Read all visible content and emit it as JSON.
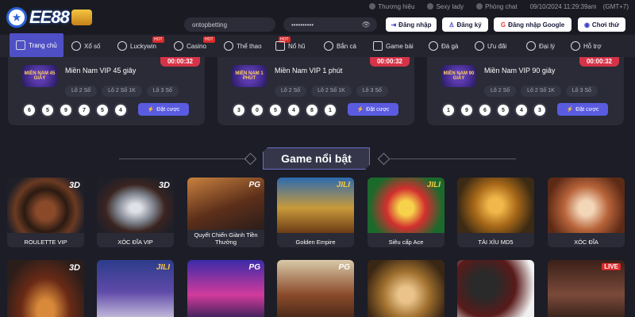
{
  "brand": {
    "name": "EE88"
  },
  "topbar": {
    "items": [
      "Thương hiệu",
      "Sexy lady",
      "Phòng chat"
    ],
    "datetime": "09/10/2024 11:29:39am",
    "timezone": "(GMT+7)"
  },
  "login": {
    "username": "ontopbetting",
    "password": "••••••••••",
    "login_label": "Đăng nhập",
    "register_label": "Đăng ký",
    "google_label": "Đăng nhập Google",
    "trial_label": "Chơi thử"
  },
  "nav": {
    "items": [
      "Trang chủ",
      "Xổ số",
      "Luckywin",
      "Casino",
      "Thể thao",
      "Nổ hũ",
      "Bắn cá",
      "Game bài",
      "Đá gà",
      "Ưu đãi",
      "Đại lý",
      "Hỗ trợ"
    ],
    "hot_label": "HOT"
  },
  "lottery": [
    {
      "title": "Miền Nam VIP 45 giây",
      "thumb": "MIỀN NAM 45 GIÂY",
      "timer": "00:00:32",
      "tabs": [
        "Lô 2 Số",
        "Lô 2 Số 1K",
        "Lô 3 Số"
      ],
      "balls": [
        "6",
        "5",
        "9",
        "7",
        "5",
        "4"
      ],
      "bet_label": "Đặt cược"
    },
    {
      "title": "Miền Nam VIP 1 phút",
      "thumb": "MIỀN NAM 1 PHÚT",
      "timer": "00:00:32",
      "tabs": [
        "Lô 2 Số",
        "Lô 2 Số 1K",
        "Lô 3 Số"
      ],
      "balls": [
        "3",
        "0",
        "5",
        "4",
        "8",
        "1"
      ],
      "bet_label": "Đặt cược"
    },
    {
      "title": "Miền Nam VIP 90 giây",
      "thumb": "MIỀN NAM 90 GIÂY",
      "timer": "00:00:32",
      "tabs": [
        "Lô 2 Số",
        "Lô 2 Số 1K",
        "Lô 3 Số"
      ],
      "balls": [
        "1",
        "9",
        "6",
        "5",
        "4",
        "3"
      ],
      "bet_label": "Đặt cược"
    }
  ],
  "section": {
    "title": "Game nổi bật"
  },
  "games_row1": [
    {
      "name": "ROULETTE VIP",
      "tag": "3D"
    },
    {
      "name": "XÓC ĐĨA VIP",
      "tag": "3D"
    },
    {
      "name": "Quyết Chiến Giành Tiền Thưởng",
      "tag": "PG"
    },
    {
      "name": "Golden Empire",
      "tag": "JILI"
    },
    {
      "name": "Siêu cấp Ace",
      "tag": "JILI"
    },
    {
      "name": "TÀI XỈU MD5",
      "tag": ""
    },
    {
      "name": "XÓC ĐĨA",
      "tag": ""
    }
  ],
  "games_row2": [
    {
      "tag": "3D"
    },
    {
      "tag": "JILI"
    },
    {
      "tag": "PG"
    },
    {
      "tag": "PG"
    },
    {
      "tag": ""
    },
    {
      "tag": ""
    },
    {
      "tag": "LIVE"
    }
  ],
  "colors": {
    "accent": "#4f50c6",
    "timer": "#d63348",
    "bg": "#1c1d26"
  }
}
